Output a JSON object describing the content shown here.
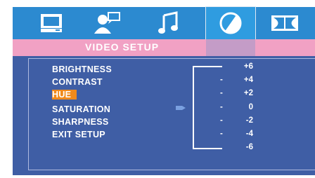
{
  "header": {
    "tabs": [
      {
        "icon": "monitor-icon",
        "active": false
      },
      {
        "icon": "speaker-person-icon",
        "active": false
      },
      {
        "icon": "music-note-icon",
        "active": false
      },
      {
        "icon": "video-disc-icon",
        "active": true
      },
      {
        "icon": "dolby-icon",
        "active": false
      }
    ],
    "title": "VIDEO SETUP"
  },
  "menu": {
    "items": [
      "BRIGHTNESS",
      "CONTRAST",
      "HUE",
      "SATURATION",
      "SHARPNESS",
      "EXIT SETUP"
    ],
    "selected": "HUE"
  },
  "scale": {
    "values": [
      "+6",
      "+4",
      "+2",
      "0",
      "-2",
      "-4",
      "-6"
    ],
    "dashes": [
      "-",
      "-",
      "-",
      "-",
      "-",
      "-"
    ],
    "current": "0"
  },
  "colors": {
    "accent": "#f08a1c",
    "panel": "#3f5ea5",
    "header": "#2c8ad0",
    "titlebar": "#f1a1c4"
  }
}
